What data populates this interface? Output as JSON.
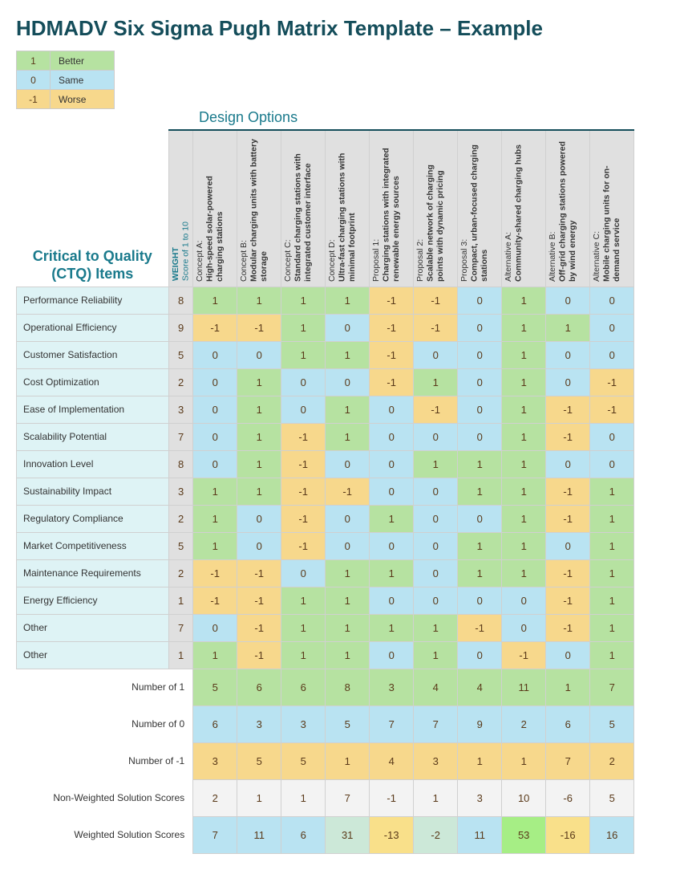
{
  "title": "HDMADV Six Sigma Pugh Matrix Template – Example",
  "legend": [
    {
      "val": "1",
      "label": "Better",
      "cls": "bg-green"
    },
    {
      "val": "0",
      "label": "Same",
      "cls": "bg-blue"
    },
    {
      "val": "-1",
      "label": "Worse",
      "cls": "bg-yellow"
    }
  ],
  "designOptionsLabel": "Design Options",
  "ctqLabel": "Critical to Quality (CTQ) Items",
  "weightHeader": "WEIGHT",
  "weightSub": "Score of 1 to 10",
  "options": [
    {
      "name": "Concept A:",
      "desc": "High-speed solar-powered charging stations"
    },
    {
      "name": "Concept B:",
      "desc": "Modular charging units with battery storage"
    },
    {
      "name": "Concept C:",
      "desc": "Standard charging stations with integrated customer interface"
    },
    {
      "name": "Concept D:",
      "desc": "Ultra-fast charging stations with minimal footprint"
    },
    {
      "name": "Proposal 1:",
      "desc": "Charging stations with integrated renewable energy sources"
    },
    {
      "name": "Proposal 2:",
      "desc": "Scalable network of charging points with dynamic pricing"
    },
    {
      "name": "Proposal 3:",
      "desc": "Compact, urban-focused charging stations"
    },
    {
      "name": "Alternative A:",
      "desc": "Community-shared charging hubs"
    },
    {
      "name": "Alternative B:",
      "desc": "Off-grid charging stations powered by wind energy"
    },
    {
      "name": "Alternative C:",
      "desc": "Mobile charging units for on-demand service"
    }
  ],
  "rows": [
    {
      "label": "Performance Reliability",
      "weight": 8,
      "vals": [
        1,
        1,
        1,
        1,
        -1,
        -1,
        0,
        1,
        0,
        0
      ]
    },
    {
      "label": "Operational Efficiency",
      "weight": 9,
      "vals": [
        -1,
        -1,
        1,
        0,
        -1,
        -1,
        0,
        1,
        1,
        0
      ]
    },
    {
      "label": "Customer Satisfaction",
      "weight": 5,
      "vals": [
        0,
        0,
        1,
        1,
        -1,
        0,
        0,
        1,
        0,
        0
      ]
    },
    {
      "label": "Cost Optimization",
      "weight": 2,
      "vals": [
        0,
        1,
        0,
        0,
        -1,
        1,
        0,
        1,
        0,
        -1
      ]
    },
    {
      "label": "Ease of Implementation",
      "weight": 3,
      "vals": [
        0,
        1,
        0,
        1,
        0,
        -1,
        0,
        1,
        -1,
        -1
      ]
    },
    {
      "label": "Scalability Potential",
      "weight": 7,
      "vals": [
        0,
        1,
        -1,
        1,
        0,
        0,
        0,
        1,
        -1,
        0
      ]
    },
    {
      "label": "Innovation Level",
      "weight": 8,
      "vals": [
        0,
        1,
        -1,
        0,
        0,
        1,
        1,
        1,
        0,
        0
      ]
    },
    {
      "label": "Sustainability Impact",
      "weight": 3,
      "vals": [
        1,
        1,
        -1,
        -1,
        0,
        0,
        1,
        1,
        -1,
        1
      ]
    },
    {
      "label": "Regulatory Compliance",
      "weight": 2,
      "vals": [
        1,
        0,
        -1,
        0,
        1,
        0,
        0,
        1,
        -1,
        1
      ]
    },
    {
      "label": "Market Competitiveness",
      "weight": 5,
      "vals": [
        1,
        0,
        -1,
        0,
        0,
        0,
        1,
        1,
        0,
        1
      ]
    },
    {
      "label": "Maintenance Requirements",
      "weight": 2,
      "vals": [
        -1,
        -1,
        0,
        1,
        1,
        0,
        1,
        1,
        -1,
        1
      ]
    },
    {
      "label": "Energy Efficiency",
      "weight": 1,
      "vals": [
        -1,
        -1,
        1,
        1,
        0,
        0,
        0,
        0,
        -1,
        1
      ]
    },
    {
      "label": "Other",
      "weight": 7,
      "vals": [
        0,
        -1,
        1,
        1,
        1,
        1,
        -1,
        0,
        -1,
        1
      ]
    },
    {
      "label": "Other",
      "weight": 1,
      "vals": [
        1,
        -1,
        1,
        1,
        0,
        1,
        0,
        -1,
        0,
        1
      ]
    }
  ],
  "summaryLabels": {
    "n1": "Number of 1",
    "n0": "Number of 0",
    "nn1": "Number of -1",
    "nw": "Non-Weighted Solution Scores",
    "w": "Weighted Solution Scores"
  },
  "summary": {
    "n1": [
      5,
      6,
      6,
      8,
      3,
      4,
      4,
      11,
      1,
      7
    ],
    "n0": [
      6,
      3,
      3,
      5,
      7,
      7,
      9,
      2,
      6,
      5
    ],
    "nn1": [
      3,
      5,
      5,
      1,
      4,
      3,
      1,
      1,
      7,
      2
    ],
    "nw": [
      2,
      1,
      1,
      7,
      -1,
      1,
      3,
      10,
      -6,
      5
    ],
    "w": [
      7,
      11,
      6,
      31,
      -13,
      -2,
      11,
      53,
      -16,
      16
    ]
  },
  "weightedHighlights": [
    "bg-blue",
    "bg-blue",
    "bg-blue",
    "bg-hl-teal",
    "bg-hl-yellow",
    "bg-hl-teal",
    "bg-blue",
    "bg-hl-green",
    "bg-hl-yellow",
    "bg-blue"
  ]
}
